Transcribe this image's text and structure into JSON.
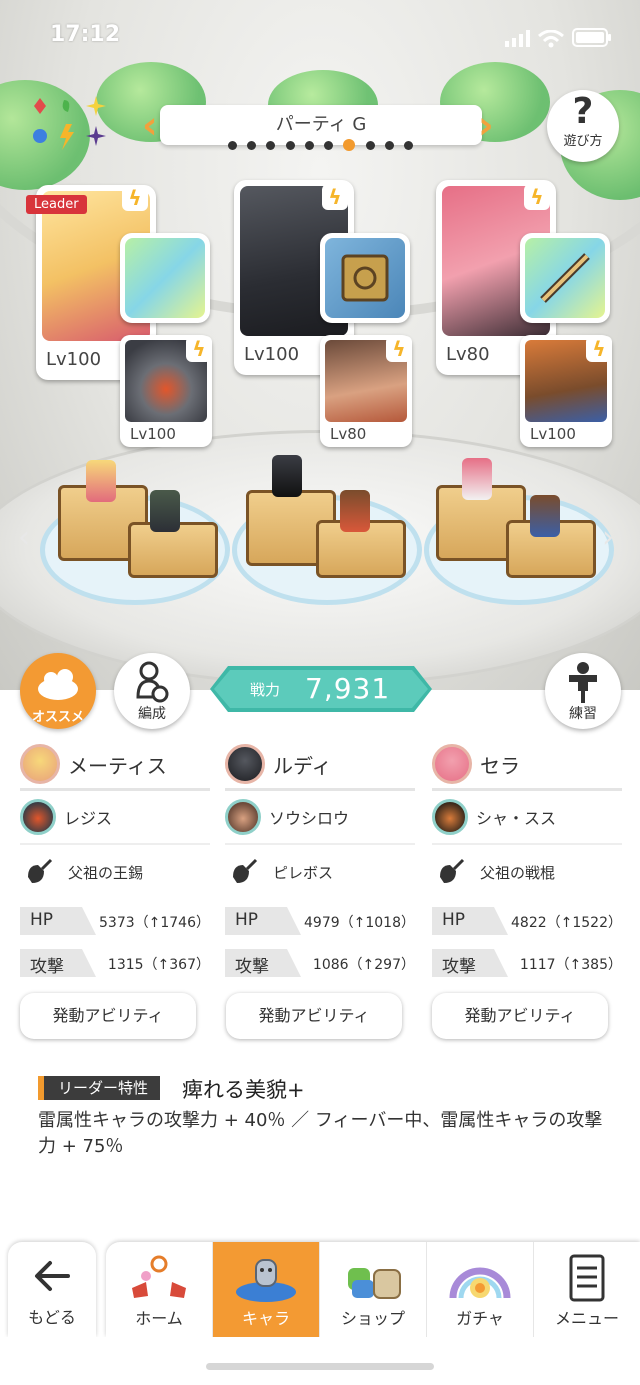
{
  "status_bar": {
    "time": "17:12"
  },
  "party": {
    "name": "パーティ G",
    "page_count": 10,
    "active_page": 7
  },
  "help": {
    "icon": "?",
    "label": "遊び方"
  },
  "leader_tag": "Leader",
  "members": [
    {
      "name": "メーティス",
      "level": "Lv100",
      "sub": {
        "name": "レジス",
        "level": "Lv100"
      },
      "weapon": "父祖の王錫",
      "hp": "HP",
      "hp_value": "5373（↑1746）",
      "atk": "攻撃",
      "atk_value": "1315（↑367）",
      "colors": {
        "portrait": "#f3d07a",
        "weapon": "#9be6c9"
      }
    },
    {
      "name": "ルディ",
      "level": "Lv100",
      "sub": {
        "name": "ソウシロウ",
        "level": "Lv80"
      },
      "weapon": "ピレボス",
      "hp": "HP",
      "hp_value": "4979（↑1018）",
      "atk": "攻撃",
      "atk_value": "1086（↑297）",
      "colors": {
        "portrait": "#3b3d44",
        "weapon": "#5b9ec7"
      }
    },
    {
      "name": "セラ",
      "level": "Lv80",
      "sub": {
        "name": "シャ・スス",
        "level": "Lv100"
      },
      "weapon": "父祖の戦棍",
      "hp": "HP",
      "hp_value": "4822（↑1522）",
      "atk": "攻撃",
      "atk_value": "1117（↑385）",
      "colors": {
        "portrait": "#f2a0ae",
        "weapon": "#a6e5c7"
      }
    }
  ],
  "controls": {
    "recommend": "オススメ",
    "formation": "編成",
    "practice": "練習",
    "power_label": "戦力",
    "power_value": "7,931"
  },
  "ability_button": "発動アビリティ",
  "leader_trait": {
    "label": "リーダー特性",
    "name": "痺れる美貌+",
    "description": "雷属性キャラの攻撃力 + 40％ ／ フィーバー中、雷属性キャラの攻撃力 + 75％"
  },
  "nav": {
    "back": "もどる",
    "items": [
      {
        "label": "ホーム",
        "icon": "home-icon"
      },
      {
        "label": "キャラ",
        "icon": "character-icon",
        "active": true
      },
      {
        "label": "ショップ",
        "icon": "shop-icon"
      },
      {
        "label": "ガチャ",
        "icon": "gacha-icon"
      },
      {
        "label": "メニュー",
        "icon": "menu-icon"
      }
    ]
  },
  "colors": {
    "accent": "#f39a33",
    "teal": "#4fc2b2",
    "lightning": "#f6b52a"
  }
}
